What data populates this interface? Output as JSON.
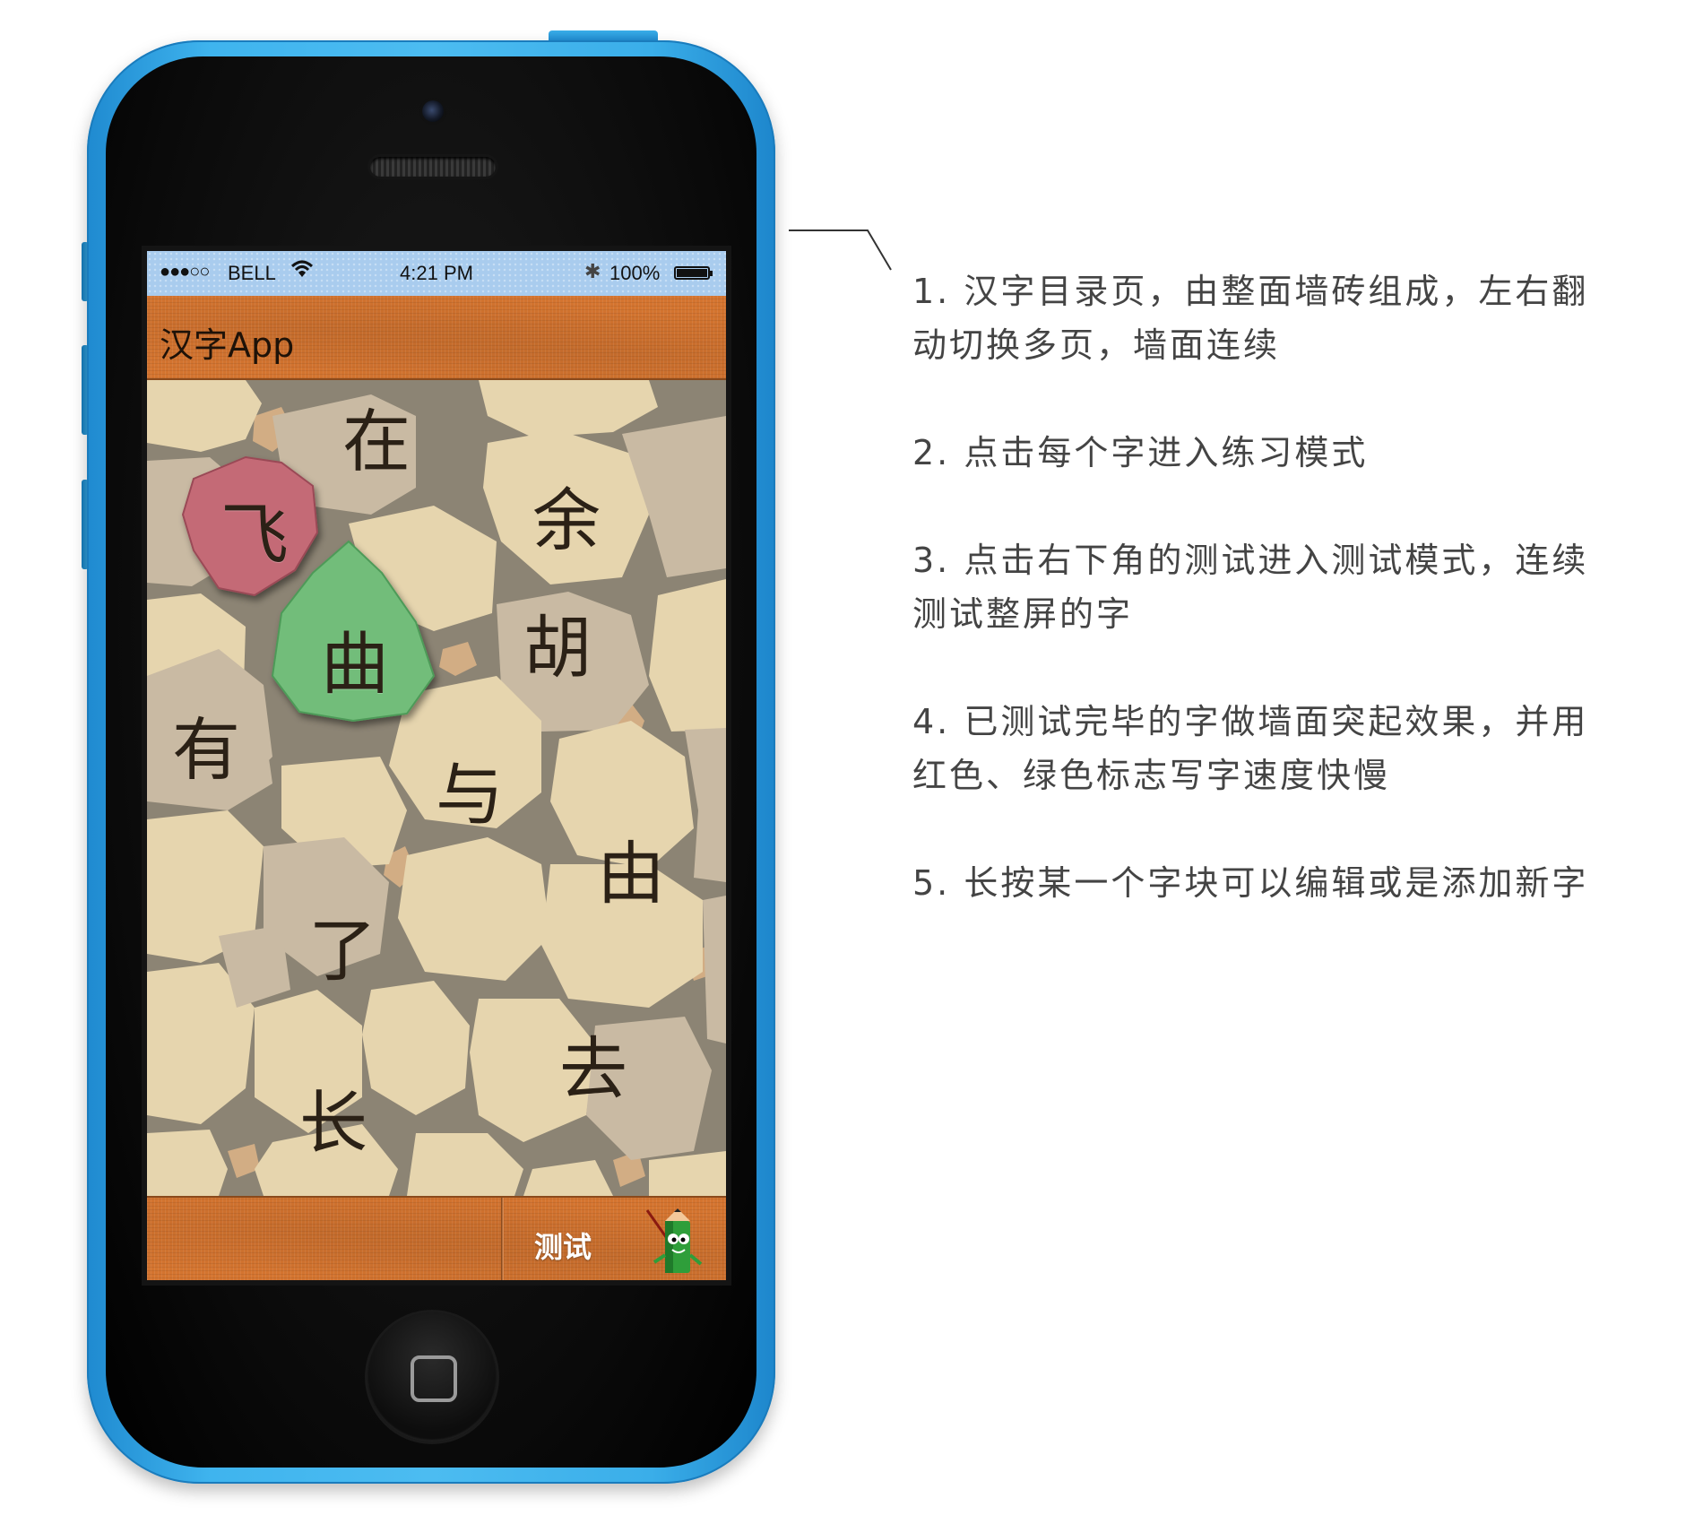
{
  "status_bar": {
    "signal": "●●●○○",
    "carrier": "BELL",
    "time": "4:21 PM",
    "battery": "100%"
  },
  "app": {
    "title": "汉字App"
  },
  "wall": {
    "characters": [
      {
        "char": "在",
        "state": "normal"
      },
      {
        "char": "飞",
        "state": "raised-red"
      },
      {
        "char": "余",
        "state": "normal"
      },
      {
        "char": "曲",
        "state": "raised-green"
      },
      {
        "char": "胡",
        "state": "normal"
      },
      {
        "char": "有",
        "state": "normal"
      },
      {
        "char": "与",
        "state": "normal"
      },
      {
        "char": "由",
        "state": "normal"
      },
      {
        "char": "了",
        "state": "normal"
      },
      {
        "char": "去",
        "state": "normal"
      },
      {
        "char": "长",
        "state": "normal"
      }
    ]
  },
  "tab_bar": {
    "test_label": "测试",
    "test_icon": "pencil-mascot-icon"
  },
  "notes": [
    "1. 汉字目录页，由整面墙砖组成，左右翻动切换多页，墙面连续",
    "2. 点击每个字进入练习模式",
    "3. 点击右下角的测试进入测试模式，连续测试整屏的字",
    "4. 已测试完毕的字做墙面突起效果，并用红色、绿色标志写字速度快慢",
    "5. 长按某一个字块可以编辑或是添加新字"
  ],
  "colors": {
    "phone_blue": "#3fb4ee",
    "bar_orange": "#d4742f",
    "status_bar_blue": "#a9ccee",
    "tile_light": "#e6d5ae",
    "tile_gray": "#c9baa3",
    "tile_red": "#c46a76",
    "tile_green": "#72bd7a",
    "grout": "#8c8474"
  }
}
